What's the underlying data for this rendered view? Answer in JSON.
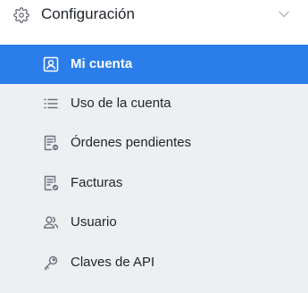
{
  "section": {
    "title": "Configuración",
    "icon": "gear-icon",
    "expand_icon": "chevron-down-icon"
  },
  "menu": {
    "items": [
      {
        "label": "Mi cuenta",
        "icon": "account-card-icon",
        "active": true
      },
      {
        "label": "Uso de la cuenta",
        "icon": "list-icon",
        "active": false
      },
      {
        "label": "Órdenes pendientes",
        "icon": "pending-orders-icon",
        "active": false
      },
      {
        "label": "Facturas",
        "icon": "invoice-icon",
        "active": false
      },
      {
        "label": "Usuario",
        "icon": "users-icon",
        "active": false
      },
      {
        "label": "Claves de API",
        "icon": "key-icon",
        "active": false
      }
    ]
  },
  "colors": {
    "accent": "#2b7de9",
    "menu_background": "#eeeff1",
    "text": "#1f2329",
    "icon": "#6b7280"
  }
}
